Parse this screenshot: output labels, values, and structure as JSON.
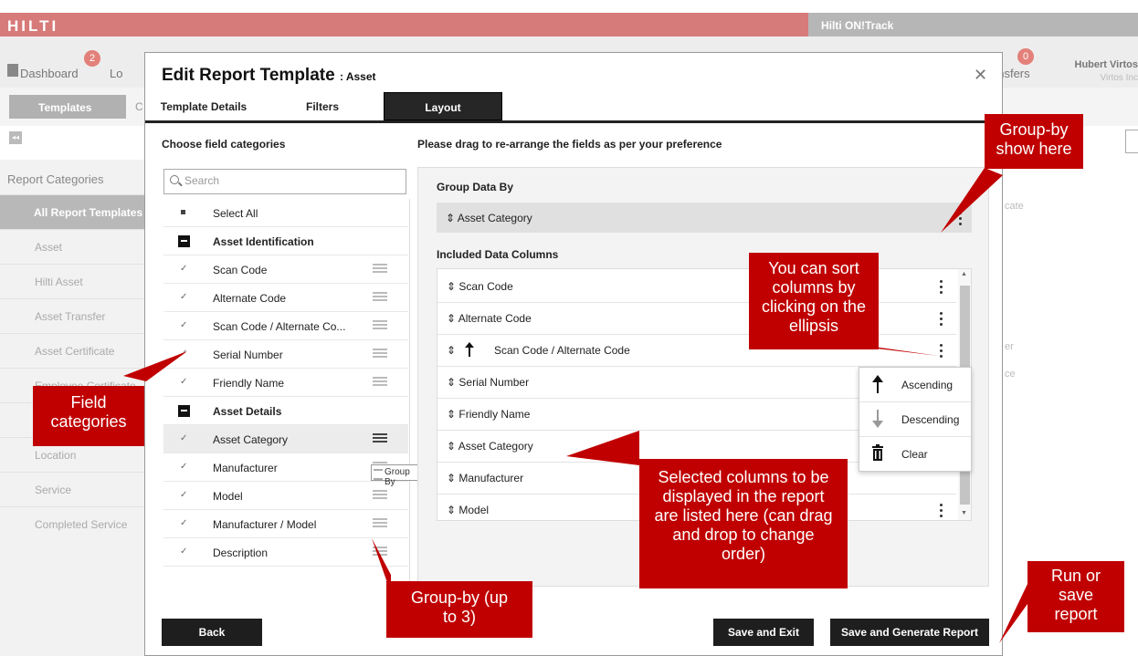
{
  "app": {
    "logo": "HILTI",
    "product": "Hilti ON!Track",
    "nav_dashboard": "Dashboard",
    "nav_dashboard_badge": "2",
    "nav_locations_partial": "Lo",
    "nav_transfers_partial": "ansfers",
    "nav_transfers_badge": "0",
    "user_name": "Hubert Virtos",
    "user_company": "Virtos Inc",
    "tab_templates": "Templates",
    "tab_partial": "C",
    "collapse_glyph": "◂◂",
    "sidebar_heading": "Report Categories",
    "sidebar_items": [
      "All Report Templates",
      "Asset",
      "Hilti Asset",
      "Asset Transfer",
      "Asset Certificate",
      "Employee Certificate",
      "",
      "Location",
      "Service",
      "Completed Service"
    ],
    "right_fragments": [
      "cate",
      "er",
      "ce"
    ]
  },
  "modal": {
    "title": "Edit Report Template",
    "title_suffix": ": Asset",
    "close": "✕",
    "tabs": [
      "Template Details",
      "Filters",
      "Layout"
    ],
    "left_heading": "Choose field categories",
    "right_heading": "Please drag to re-arrange the fields as per your preference",
    "search_placeholder": "Search",
    "select_all": "Select All",
    "fields": [
      {
        "label": "Asset Identification",
        "category": true
      },
      {
        "label": "Scan Code"
      },
      {
        "label": "Alternate Code"
      },
      {
        "label": "Scan Code / Alternate Co..."
      },
      {
        "label": "Serial Number"
      },
      {
        "label": "Friendly Name"
      },
      {
        "label": "Asset Details",
        "category": true
      },
      {
        "label": "Asset Category"
      },
      {
        "label": "Manufacturer"
      },
      {
        "label": "Model"
      },
      {
        "label": "Manufacturer / Model"
      },
      {
        "label": "Description"
      }
    ],
    "group_by_tooltip": "Group By",
    "group_data_by_label": "Group Data By",
    "group_data_by_item": "⇕ Asset Category",
    "included_columns_label": "Included Data Columns",
    "columns": [
      "⇕ Scan Code",
      "⇕ Alternate Code",
      "Scan Code / Alternate Code",
      "⇕ Serial Number",
      "⇕ Friendly Name",
      "⇕ Asset Category",
      "⇕ Manufacturer",
      "⇕ Model"
    ],
    "sort_menu": [
      "Ascending",
      "Descending",
      "Clear"
    ],
    "buttons": {
      "back": "Back",
      "save_exit": "Save and Exit",
      "save_generate": "Save and Generate Report"
    }
  },
  "annotations": {
    "group_by_show": "Group-by show here",
    "sort_columns": "You can sort columns by clicking on the ellipsis",
    "field_categories": "Field categories",
    "selected_columns": "Selected columns to be displayed in the report are listed here (can drag and drop to change order)",
    "group_by_up_to": "Group-by (up to 3)",
    "run_or_save": "Run or save report"
  },
  "colors": {
    "callout": "#c00000",
    "dark_button": "#1e1e1e",
    "header_red": "#d77a7a"
  }
}
